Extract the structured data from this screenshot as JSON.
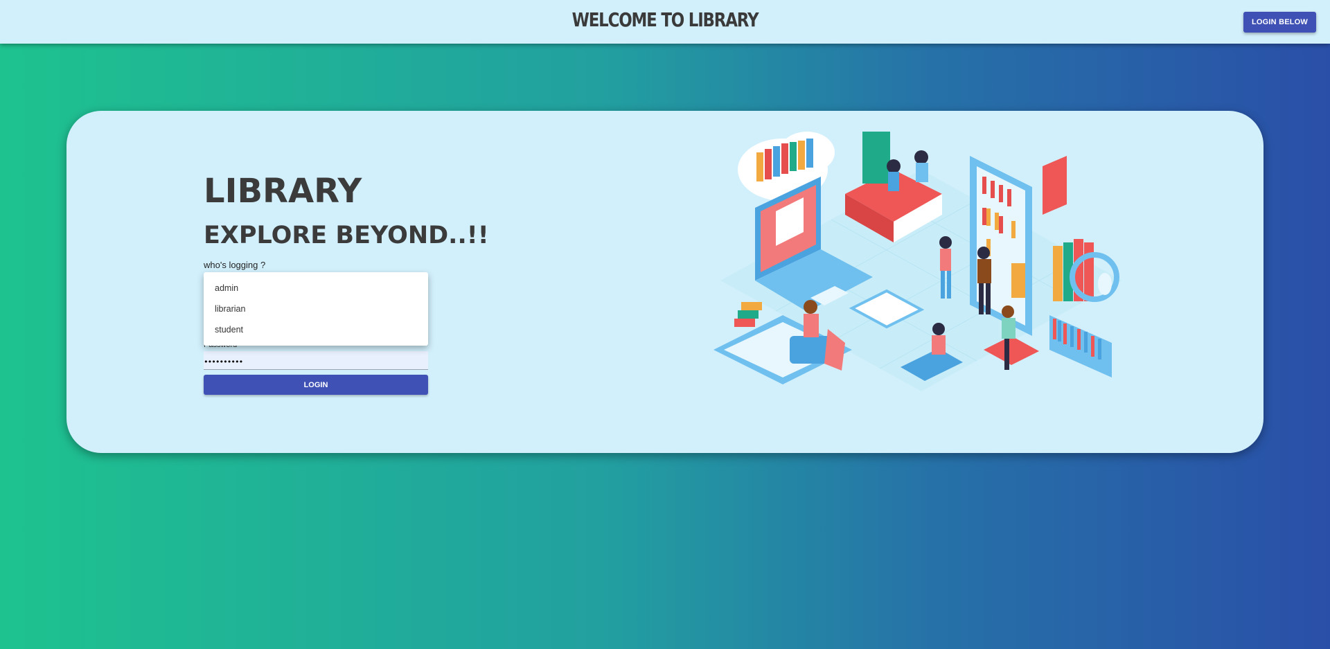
{
  "header": {
    "title": "WELCOME  TO LIBRARY",
    "login_below_label": "LOGIN BELOW"
  },
  "hero": {
    "title": "LIBRARY",
    "subtitle": "EXPLORE BEYOND..!!"
  },
  "form": {
    "role_label": "who's logging ?",
    "role_options": [
      "admin",
      "librarian",
      "student"
    ],
    "password_label": "Password",
    "password_value": "••••••••••",
    "login_label": "LOGIN"
  },
  "colors": {
    "accent": "#3f51b5",
    "panel": "#d2f0fc",
    "gradient_start": "#1ec28f",
    "gradient_end": "#2a4fa8"
  },
  "illustration": {
    "icon": "library-isometric-illustration"
  }
}
